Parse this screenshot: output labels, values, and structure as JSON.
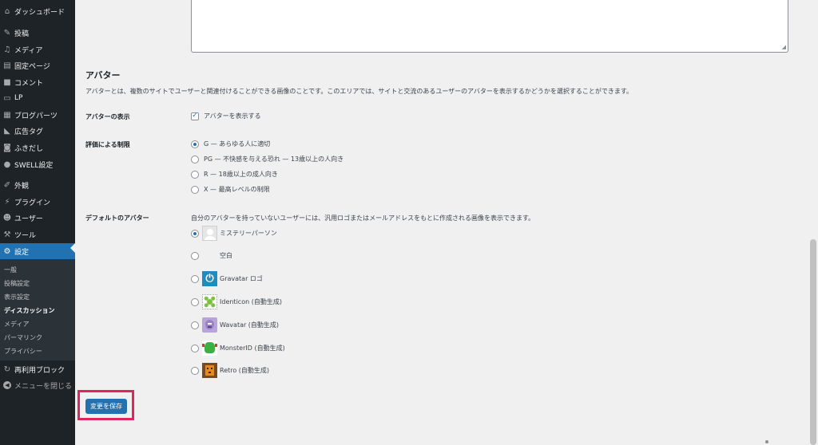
{
  "sidebar": {
    "items": [
      {
        "label": "ダッシュボード",
        "icon": "dashboard-icon",
        "glyph": "⌂"
      },
      {
        "label": "投稿",
        "icon": "pushpin-icon",
        "glyph": "✎"
      },
      {
        "label": "メディア",
        "icon": "media-icon",
        "glyph": "♫"
      },
      {
        "label": "固定ページ",
        "icon": "page-icon",
        "glyph": "▤"
      },
      {
        "label": "コメント",
        "icon": "comment-icon",
        "glyph": "■"
      },
      {
        "label": "LP",
        "icon": "document-icon",
        "glyph": "▭"
      },
      {
        "label": "ブログパーツ",
        "icon": "grid-icon",
        "glyph": "▦"
      },
      {
        "label": "広告タグ",
        "icon": "megaphone-icon",
        "glyph": "◣"
      },
      {
        "label": "ふきだし",
        "icon": "speech-bubble-icon",
        "glyph": "◙"
      },
      {
        "label": "SWELL設定",
        "icon": "swell-icon",
        "glyph": "●"
      },
      {
        "label": "外観",
        "icon": "brush-icon",
        "glyph": "✐"
      },
      {
        "label": "プラグイン",
        "icon": "plugin-icon",
        "glyph": "⚡"
      },
      {
        "label": "ユーザー",
        "icon": "user-icon",
        "glyph": "☻"
      },
      {
        "label": "ツール",
        "icon": "wrench-icon",
        "glyph": "⚒"
      },
      {
        "label": "設定",
        "icon": "settings-icon",
        "glyph": "⚙"
      }
    ],
    "submenu": [
      "一般",
      "投稿設定",
      "表示設定",
      "ディスカッション",
      "メディア",
      "パーマリンク",
      "プライバシー"
    ],
    "reusable_blocks": {
      "label": "再利用ブロック",
      "icon": "reusable-block-icon",
      "glyph": "↻"
    },
    "collapse": {
      "label": "メニューを閉じる",
      "icon": "collapse-icon",
      "glyph": "◀"
    }
  },
  "avatar_section": {
    "title": "アバター",
    "description": "アバターとは、複数のサイトでユーザーと関連付けることができる画像のことです。このエリアでは、サイトと交流のあるユーザーのアバターを表示するかどうかを選択することができます。",
    "show_avatars": {
      "label": "アバターの表示",
      "checkbox_label": "アバターを表示する",
      "checked": true
    },
    "rating": {
      "label": "評価による制限",
      "options": [
        "G — あらゆる人に適切",
        "PG — 不快感を与える恐れ — 13歳以上の人向き",
        "R — 18歳以上の成人向き",
        "X — 最高レベルの制限"
      ],
      "selected_index": 0
    },
    "default_avatar": {
      "label": "デフォルトのアバター",
      "description": "自分のアバターを持っていないユーザーには、汎用ロゴまたはメールアドレスをもとに作成される画像を表示できます。",
      "options": [
        {
          "label": "ミステリーパーソン",
          "icon": "mystery-person-avatar"
        },
        {
          "label": "空白",
          "icon": "blank-avatar"
        },
        {
          "label": "Gravatar ロゴ",
          "icon": "gravatar-logo-avatar"
        },
        {
          "label": "Identicon (自動生成)",
          "icon": "identicon-avatar"
        },
        {
          "label": "Wavatar (自動生成)",
          "icon": "wavatar-avatar"
        },
        {
          "label": "MonsterID (自動生成)",
          "icon": "monsterid-avatar"
        },
        {
          "label": "Retro (自動生成)",
          "icon": "retro-avatar"
        }
      ],
      "selected_index": 0
    }
  },
  "save_button": {
    "label": "変更を保存"
  },
  "colors": {
    "accent": "#2271b1",
    "sidebar_bg": "#1d2327",
    "submenu_bg": "#2c3338",
    "highlight": "#e0245e",
    "page_bg": "#f0f0f1"
  }
}
